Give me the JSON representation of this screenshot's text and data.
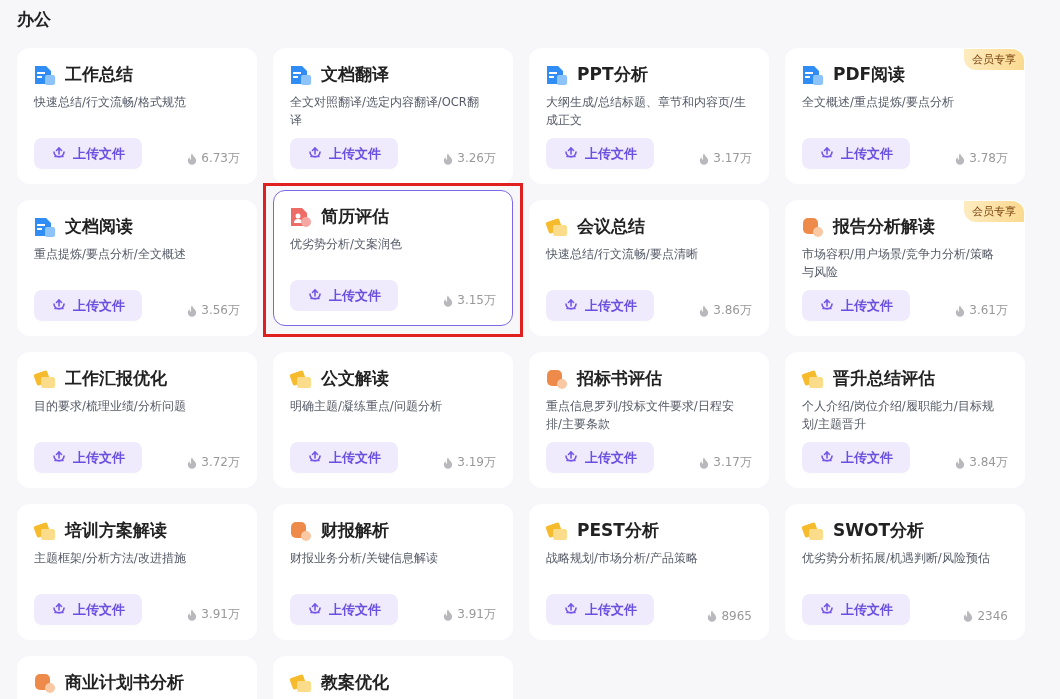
{
  "section_title": "办公",
  "cards": [
    {
      "kind": "doc",
      "title": "工作总结",
      "desc": "快速总结/行文流畅/格式规范",
      "button": "上传文件",
      "count": "6.73万",
      "selected": false
    },
    {
      "kind": "doc",
      "title": "文档翻译",
      "desc": "全文对照翻译/选定内容翻译/OCR翻译",
      "button": "上传文件",
      "count": "3.26万",
      "selected": false
    },
    {
      "kind": "doc",
      "title": "PPT分析",
      "desc": "大纲生成/总结标题、章节和内容页/生成正文",
      "button": "上传文件",
      "count": "3.17万",
      "selected": false
    },
    {
      "kind": "doc",
      "title": "PDF阅读",
      "desc": "全文概述/重点提炼/要点分析",
      "button": "上传文件",
      "count": "3.78万",
      "badge": "会员专享",
      "selected": false
    },
    {
      "kind": "doc",
      "title": "文档阅读",
      "desc": "重点提炼/要点分析/全文概述",
      "button": "上传文件",
      "count": "3.56万",
      "selected": false
    },
    {
      "kind": "resume",
      "title": "简历评估",
      "desc": "优劣势分析/文案润色",
      "button": "上传文件",
      "count": "3.15万",
      "selected": true
    },
    {
      "kind": "folder",
      "title": "会议总结",
      "desc": "快速总结/行文流畅/要点清晰",
      "button": "上传文件",
      "count": "3.86万",
      "selected": false
    },
    {
      "kind": "money",
      "title": "报告分析解读",
      "desc": "市场容积/用户场景/竞争力分析/策略与风险",
      "button": "上传文件",
      "count": "3.61万",
      "badge": "会员专享",
      "selected": false
    },
    {
      "kind": "folder",
      "title": "工作汇报优化",
      "desc": "目的要求/梳理业绩/分析问题",
      "button": "上传文件",
      "count": "3.72万",
      "selected": false
    },
    {
      "kind": "folder",
      "title": "公文解读",
      "desc": "明确主题/凝练重点/问题分析",
      "button": "上传文件",
      "count": "3.19万",
      "selected": false
    },
    {
      "kind": "money",
      "title": "招标书评估",
      "desc": "重点信息罗列/投标文件要求/日程安排/主要条款",
      "button": "上传文件",
      "count": "3.17万",
      "selected": false
    },
    {
      "kind": "folder",
      "title": "晋升总结评估",
      "desc": "个人介绍/岗位介绍/履职能力/目标规划/主题晋升",
      "button": "上传文件",
      "count": "3.84万",
      "selected": false
    },
    {
      "kind": "folder",
      "title": "培训方案解读",
      "desc": "主题框架/分析方法/改进措施",
      "button": "上传文件",
      "count": "3.91万",
      "selected": false
    },
    {
      "kind": "money",
      "title": "财报解析",
      "desc": "财报业务分析/关键信息解读",
      "button": "上传文件",
      "count": "3.91万",
      "selected": false
    },
    {
      "kind": "folder",
      "title": "PEST分析",
      "desc": "战略规划/市场分析/产品策略",
      "button": "上传文件",
      "count": "8965",
      "selected": false
    },
    {
      "kind": "folder",
      "title": "SWOT分析",
      "desc": "优劣势分析拓展/机遇判断/风险预估",
      "button": "上传文件",
      "count": "2346",
      "selected": false
    },
    {
      "kind": "money",
      "title": "商业计划书分析",
      "selected": false
    },
    {
      "kind": "folder",
      "title": "教案优化",
      "selected": false
    }
  ]
}
